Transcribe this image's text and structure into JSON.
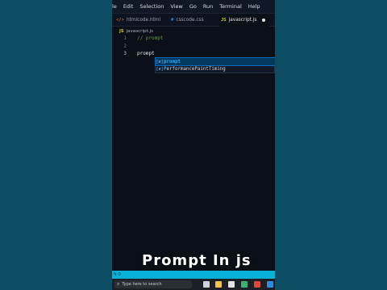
{
  "menubar": {
    "items": [
      "le",
      "Edit",
      "Selection",
      "View",
      "Go",
      "Run",
      "Terminal",
      "Help"
    ]
  },
  "tabs": [
    {
      "icon": "</>",
      "label": "htmlcode.html",
      "color": "#e37933",
      "active": false
    },
    {
      "icon": "#",
      "label": "csscode.css",
      "color": "#42a5f5",
      "active": false
    },
    {
      "icon": "JS",
      "label": "javascript.js",
      "color": "#cbcb41",
      "active": true,
      "unsaved": true
    }
  ],
  "breadcrumb": {
    "icon": "JS",
    "file": "javascript.js"
  },
  "editor": {
    "lines": [
      {
        "number": "1",
        "text": "// prompt"
      },
      {
        "number": "2",
        "text": ""
      },
      {
        "number": "3",
        "text": "prompt"
      }
    ]
  },
  "suggestions": [
    {
      "kind": "[ø]",
      "match": "prompt",
      "rest": ""
    },
    {
      "kind": "[ø]",
      "match": "P",
      "rest": "erformancePaintTiming"
    }
  ],
  "overlay": {
    "title": "Prompt In js"
  },
  "statusbar": {
    "text": "Ϟ 0"
  },
  "taskbar": {
    "search_placeholder": "Type here to search"
  }
}
